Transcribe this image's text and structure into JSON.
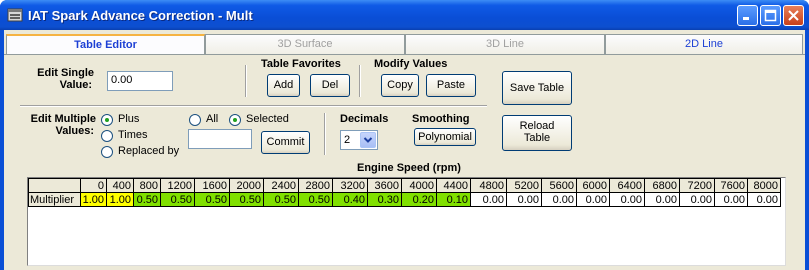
{
  "window": {
    "title": "IAT Spark Advance Correction - Mult",
    "app_icon": "app-window-icon"
  },
  "tabs": [
    {
      "label": "Table Editor",
      "active": true
    },
    {
      "label": "3D Surface",
      "active": false
    },
    {
      "label": "3D Line",
      "active": false
    },
    {
      "label": "2D Line",
      "active": false
    }
  ],
  "edit_single": {
    "label_line1": "Edit Single",
    "label_line2": "Value:",
    "value": "0.00"
  },
  "favorites": {
    "title": "Table Favorites",
    "add_label": "Add",
    "del_label": "Del"
  },
  "modify": {
    "title": "Modify Values",
    "copy_label": "Copy",
    "paste_label": "Paste"
  },
  "save_table_label": "Save Table",
  "reload_table_label_line1": "Reload",
  "reload_table_label_line2": "Table",
  "edit_multiple": {
    "label_line1": "Edit Multiple",
    "label_line2": "Values:",
    "options": [
      "Plus",
      "Times",
      "Replaced by"
    ],
    "selected_option": "Plus",
    "scope_options": [
      "All",
      "Selected"
    ],
    "selected_scope": "Selected",
    "value": "",
    "commit_label": "Commit"
  },
  "decimals": {
    "title": "Decimals",
    "value": "2"
  },
  "smoothing": {
    "title": "Smoothing",
    "button_label": "Polynomial"
  },
  "table": {
    "axis_title": "Engine Speed (rpm)",
    "columns": [
      "0",
      "400",
      "800",
      "1200",
      "1600",
      "2000",
      "2400",
      "2800",
      "3200",
      "3600",
      "4000",
      "4400",
      "4800",
      "5200",
      "5600",
      "6000",
      "6400",
      "6800",
      "7200",
      "7600",
      "8000"
    ],
    "row_label": "Multiplier",
    "values": [
      "1.00",
      "1.00",
      "0.50",
      "0.50",
      "0.50",
      "0.50",
      "0.50",
      "0.50",
      "0.40",
      "0.30",
      "0.20",
      "0.10",
      "0.00",
      "0.00",
      "0.00",
      "0.00",
      "0.00",
      "0.00",
      "0.00",
      "0.00",
      "0.00"
    ],
    "cell_colors": [
      "#ffff00",
      "#ffff00",
      "#80e000",
      "#80e000",
      "#80e000",
      "#80e000",
      "#80e000",
      "#80e000",
      "#80e000",
      "#80e000",
      "#80e000",
      "#80e000",
      "#ffffff",
      "#ffffff",
      "#ffffff",
      "#ffffff",
      "#ffffff",
      "#ffffff",
      "#ffffff",
      "#ffffff",
      "#ffffff"
    ]
  },
  "colors": {
    "title_bar": "#0a4ed6",
    "active_tab_text": "#1c3fd4",
    "high_value": "#ffff00",
    "mid_value": "#80e000"
  }
}
